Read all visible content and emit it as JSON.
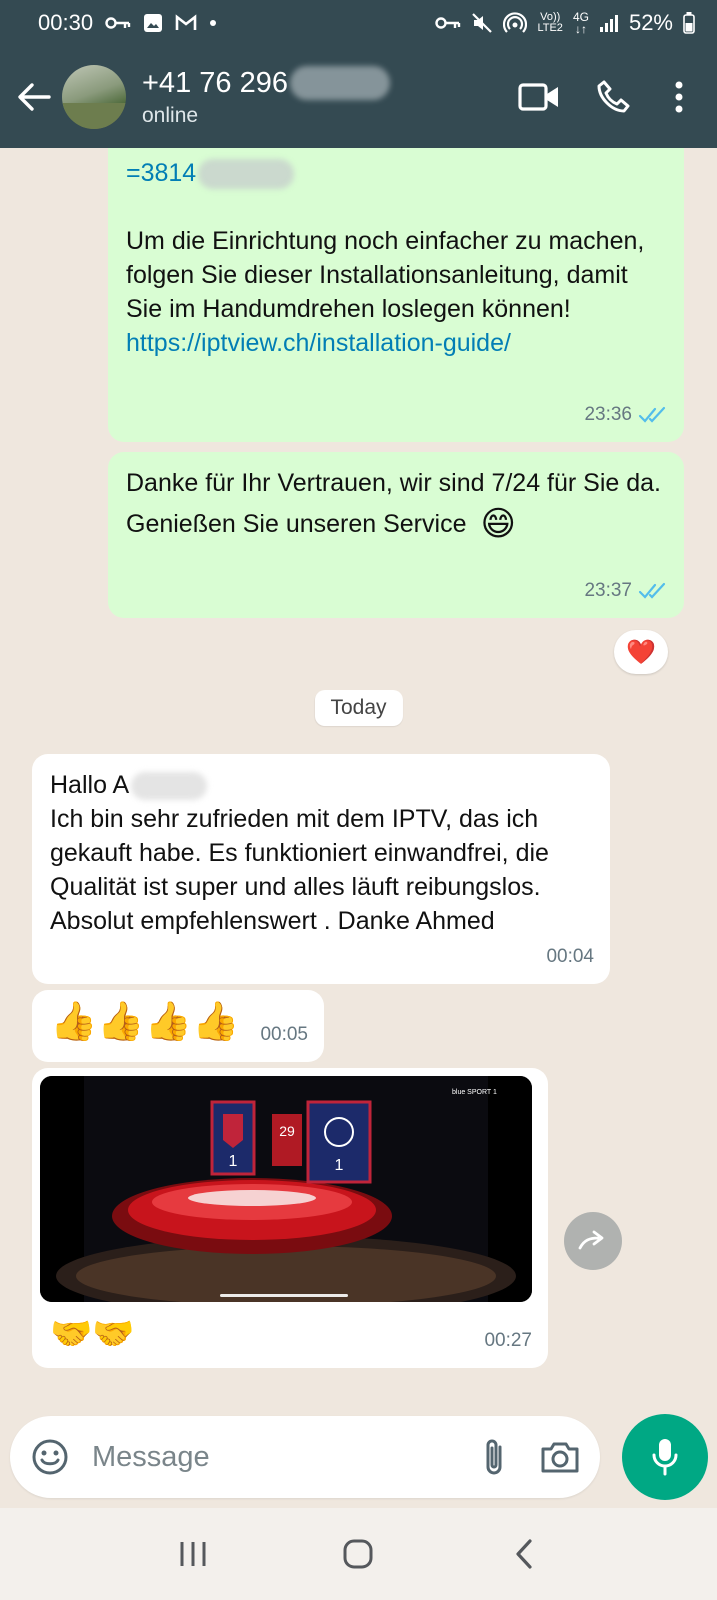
{
  "status_bar": {
    "time": "00:30",
    "battery": "52%",
    "network_label": "4G",
    "volte_label": "LTE2"
  },
  "header": {
    "contact_number": "+41 76 296",
    "status": "online"
  },
  "messages": {
    "m1_link_fragment": "=3814",
    "m1_text": "Um die Einrichtung noch einfacher zu machen, folgen Sie dieser Installationsanleitung, damit Sie im Handumdrehen loslegen können!",
    "m1_link": "https://iptview.ch/installation-guide/",
    "m1_time": "23:36",
    "m2_line1": "Danke für Ihr Vertrauen, wir sind 7/24 für Sie da.",
    "m2_line2": "Genießen Sie unseren Service",
    "m2_emoji": "😄",
    "m2_time": "23:37",
    "m2_reaction": "❤️",
    "day_divider": "Today",
    "m3_greeting": "Hallo A",
    "m3_text": "Ich bin sehr zufrieden mit dem IPTV, das ich gekauft habe. Es funktioniert einwandfrei, die Qualität ist super und alles läuft reibungslos. Absolut empfehlenswert . Danke Ahmed",
    "m3_time": "00:04",
    "m4_emojis": "👍👍👍👍",
    "m4_time": "00:05",
    "m5_emojis": "🤝🤝",
    "m5_time": "00:27"
  },
  "video": {
    "score_home": "1",
    "score_away": "1",
    "minute": "29",
    "channel_logo": "blue SPORT 1"
  },
  "composer": {
    "placeholder": "Message"
  },
  "colors": {
    "header_bg": "#344a52",
    "outgoing_bubble": "#d9fdd3",
    "incoming_bubble": "#ffffff",
    "chat_bg": "#efe7de",
    "link": "#027eb5",
    "accent": "#00a884",
    "read_tick": "#53bdeb"
  }
}
